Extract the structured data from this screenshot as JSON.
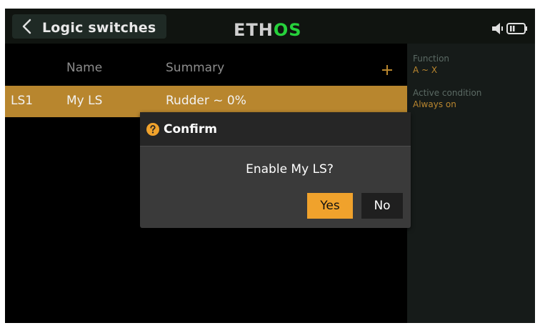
{
  "header": {
    "title": "Logic switches",
    "logo_left": "ETH",
    "logo_right": "OS",
    "back_icon": "chevron-left-icon",
    "speaker_icon": "speaker-icon",
    "battery_icon": "battery-icon"
  },
  "table": {
    "columns": [
      "Name",
      "Summary"
    ],
    "add_icon": "plus-icon",
    "rows": [
      {
        "id": "LS1",
        "name": "My LS",
        "summary": "Rudder ~ 0%"
      }
    ]
  },
  "side_panel": {
    "function_label": "Function",
    "function_value": "A ~ X",
    "active_condition_label": "Active condition",
    "active_condition_value": "Always on"
  },
  "dialog": {
    "title": "Confirm",
    "icon": "question-icon",
    "message": "Enable My LS?",
    "yes_label": "Yes",
    "no_label": "No"
  },
  "colors": {
    "accent": "#b8862e",
    "button_yes": "#f0a22c",
    "logo_green": "#26d13b",
    "dialog_bg": "#3a3a3a",
    "side_panel_bg": "#161b19"
  }
}
